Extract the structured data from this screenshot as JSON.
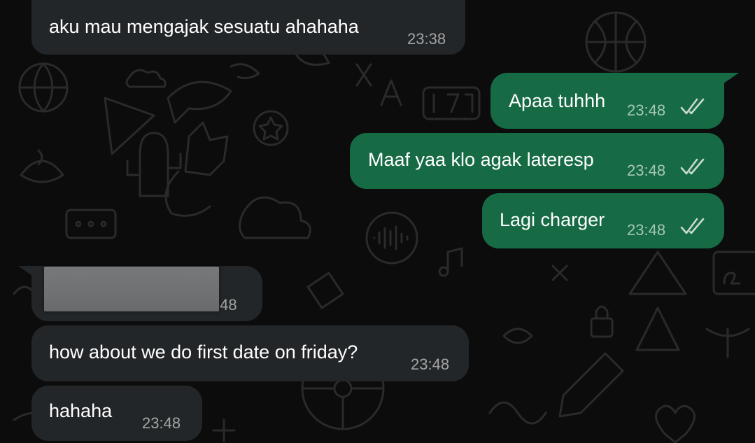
{
  "colors": {
    "background": "#0c0c0c",
    "incoming_bubble": "#232628",
    "outgoing_bubble": "#166b44",
    "read_ticks": "#c9d9d0"
  },
  "messages": [
    {
      "direction": "in",
      "text": "aku mau mengajak sesuatu ahahaha",
      "time": "23:38"
    },
    {
      "direction": "out",
      "text": "Apaa tuhhh",
      "time": "23:48",
      "status": "read"
    },
    {
      "direction": "out",
      "text": "Maaf yaa klo agak lateresp",
      "time": "23:48",
      "status": "read"
    },
    {
      "direction": "out",
      "text": "Lagi charger",
      "time": "23:48",
      "status": "read"
    },
    {
      "direction": "in",
      "text": "",
      "time_partial": ":48",
      "redacted": true
    },
    {
      "direction": "in",
      "text": "how about we do first date on friday?",
      "time": "23:48"
    },
    {
      "direction": "in",
      "text": "hahaha",
      "time": "23:48"
    }
  ]
}
